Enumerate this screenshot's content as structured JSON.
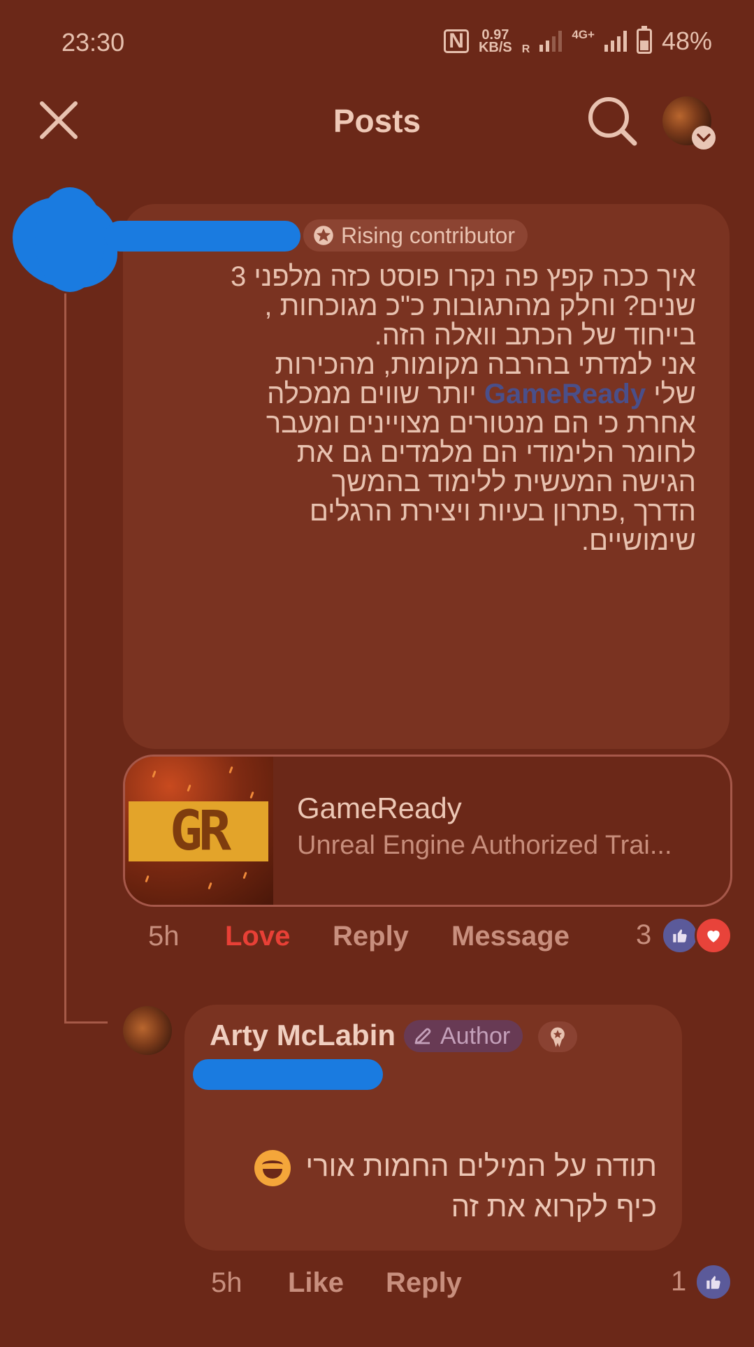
{
  "status_bar": {
    "time": "23:30",
    "nfc": "N",
    "speed_value": "0.97",
    "speed_unit": "KB/S",
    "roaming": "R",
    "network": "4G+",
    "battery": "48%"
  },
  "header": {
    "title": "Posts"
  },
  "comment": {
    "badge_label": "Rising contributor",
    "lines": [
      "איך ככה קפץ פה נקרו פוסט כזה מלפני 3",
      "שנים? וחלק מהתגובות כ\"כ מגוכחות ,",
      "בייחוד של הכתב וואלה הזה.",
      "אני למדתי בהרבה מקומות,  מהכירות",
      "שלי",
      "GameReady",
      "יותר שווים ממכלה",
      "אחרת כי הם מנטורים מצויינים ומעבר",
      "לחומר הלימודי הם מלמדים גם את",
      "הגישה המעשית ללימוד בהמשך",
      "הדרך ,פתרון בעיות ויצירת הרגלים",
      "שימושיים."
    ],
    "link_card": {
      "logo_text": "GR",
      "title": "GameReady",
      "subtitle": "Unreal Engine Authorized Trai..."
    },
    "time": "5h",
    "love_label": "Love",
    "reply_label": "Reply",
    "message_label": "Message",
    "reaction_count": "3"
  },
  "reply": {
    "author_name": "Arty McLabin",
    "author_badge": "Author",
    "lines": [
      "תודה על המילים החמות אורי",
      "כיף לקרוא את זה"
    ],
    "time": "5h",
    "like_label": "Like",
    "reply_label": "Reply",
    "reaction_count": "1"
  },
  "colors": {
    "background": "#6b2818",
    "bubble": "#7a3321",
    "love": "#e84036",
    "mention": "#4a4f8a",
    "redaction": "#1a7be0"
  },
  "icons": [
    "close-icon",
    "search-icon",
    "chevron-down-icon",
    "star-icon",
    "pencil-icon",
    "medal-icon",
    "like-icon",
    "heart-icon",
    "grin-emoji-icon"
  ]
}
